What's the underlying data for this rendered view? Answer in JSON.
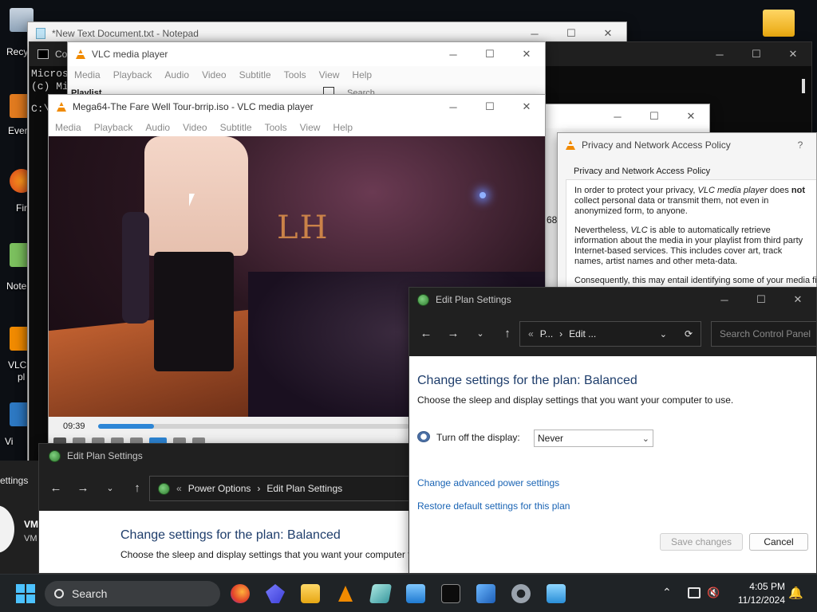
{
  "desktop": {
    "icons": [
      {
        "label": "Recy"
      },
      {
        "label": "Ever"
      },
      {
        "label": "Fir"
      },
      {
        "label": "Note"
      },
      {
        "label": "VLC"
      },
      {
        "label": "pl"
      },
      {
        "label": "Vi"
      }
    ]
  },
  "notepad": {
    "title": "*New Text Document.txt - Notepad"
  },
  "cmd": {
    "title": "Co",
    "lines": [
      "Micros",
      "(c) Mi",
      "C:\\"
    ]
  },
  "vlc_playlist": {
    "title": "VLC media player",
    "menu": [
      "Media",
      "Playback",
      "Audio",
      "Video",
      "Subtitle",
      "Tools",
      "View",
      "Help"
    ],
    "playlist_label": "Playlist",
    "search_placeholder": "Search"
  },
  "vlc_main": {
    "title": "Mega64-The Fare Well Tour-brrip.iso - VLC media player",
    "menu": [
      "Media",
      "Playback",
      "Audio",
      "Video",
      "Subtitle",
      "Tools",
      "View",
      "Help"
    ],
    "time": "09:39",
    "progress": 0.18
  },
  "side_num": "68",
  "privacy": {
    "title": "Privacy and Network Access Policy",
    "help": "?",
    "heading": "Privacy and Network Access Policy",
    "p1_a": "In order to protect your privacy, ",
    "p1_em": "VLC media player",
    "p1_b": " does ",
    "p1_strong": "not",
    "p1_c": " collect personal data or transmit them, not even in anonymized form, to anyone.",
    "p2_a": "Nevertheless, ",
    "p2_em": "VLC",
    "p2_b": " is able to automatically retrieve information about the media in your playlist from third party Internet-based services. This includes cover art, track names, artist names and other meta-data.",
    "p3": "Consequently, this may entail identifying some of your media fil"
  },
  "edit_plan_front": {
    "title": "Edit Plan Settings",
    "breadcrumb_p": "P...",
    "breadcrumb_sep": "›",
    "breadcrumb_edit": "Edit ...",
    "search_placeholder": "Search Control Panel",
    "heading": "Change settings for the plan: Balanced",
    "subheading": "Choose the sleep and display settings that you want your computer to use.",
    "display_label": "Turn off the display:",
    "display_value": "Never",
    "advanced_link": "Change advanced power settings",
    "restore_link": "Restore default settings for this plan",
    "save_label": "Save changes",
    "cancel_label": "Cancel"
  },
  "edit_plan_back": {
    "title": "Edit Plan Settings",
    "crumb_prefix": "«",
    "crumb_1": "Power Options",
    "crumb_sep": "›",
    "crumb_2": "Edit Plan Settings",
    "heading": "Change settings for the plan: Balanced",
    "subheading": "Choose the sleep and display settings that you want your computer t",
    "left_settings": "ettings",
    "vm_1": "VM",
    "vm_2": "VM"
  },
  "taskbar": {
    "search_label": "Search",
    "time": "4:05 PM",
    "date": "11/12/2024"
  },
  "colors": {
    "accent": "#1a64b4",
    "heading": "#1e3d6b",
    "taskbar": "#1f2326"
  }
}
